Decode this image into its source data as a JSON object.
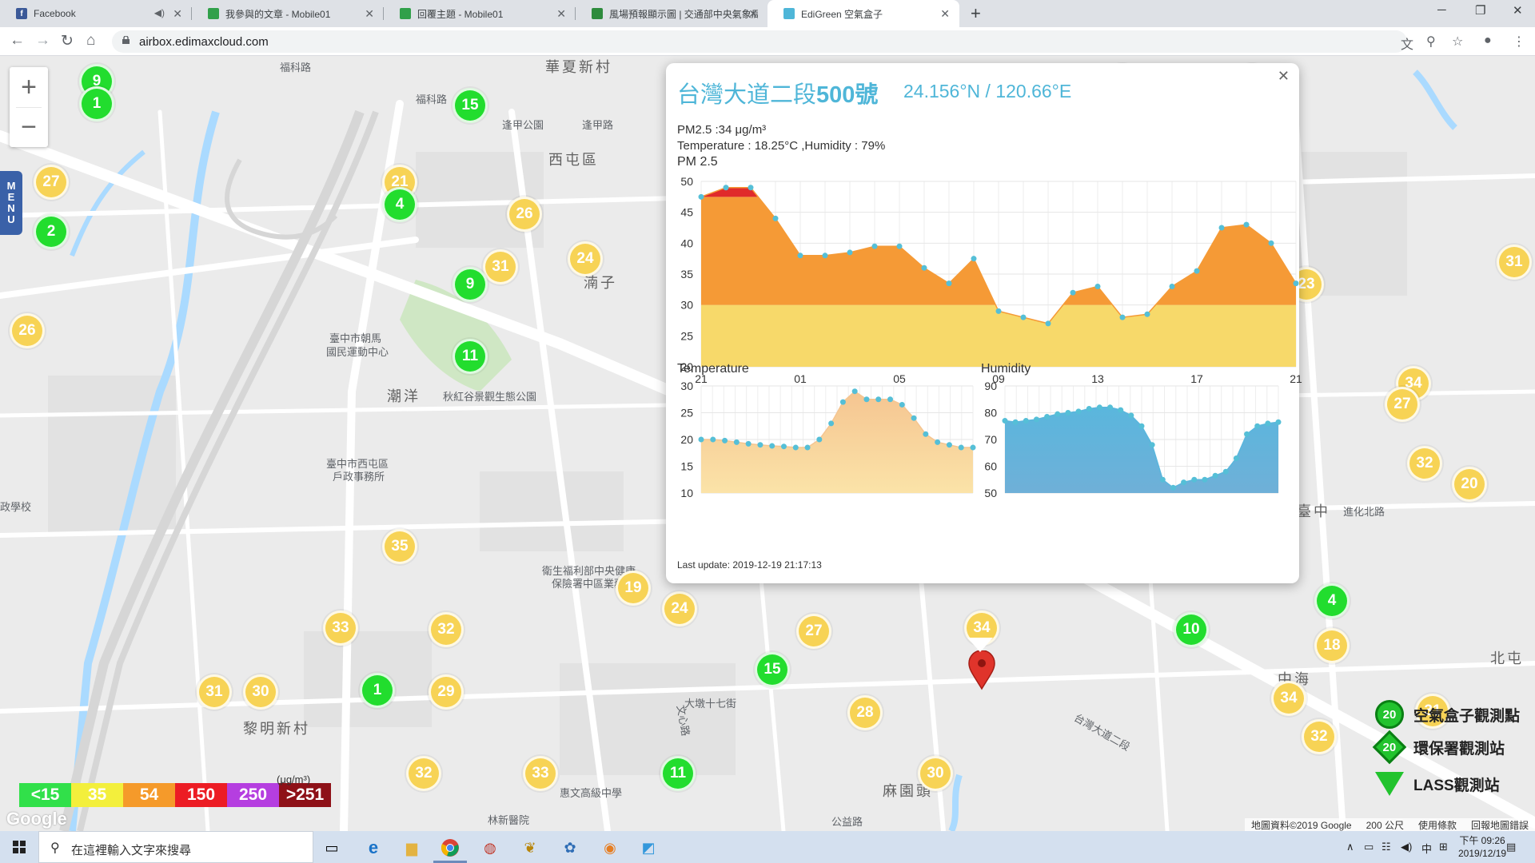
{
  "browser": {
    "tabs": [
      {
        "title": "Facebook",
        "fav": "f",
        "color": "#3b5998",
        "muted": true
      },
      {
        "title": "我參與的文章 - Mobile01",
        "fav": "",
        "color": "#31a04a"
      },
      {
        "title": "回覆主題 - Mobile01",
        "fav": "",
        "color": "#31a04a"
      },
      {
        "title": "風場預報顯示圖 | 交通部中央氣象局",
        "fav": "",
        "color": "#2e8b3d"
      },
      {
        "title": "EdiGreen 空氣盒子",
        "fav": "",
        "color": "#4fb6d8"
      }
    ],
    "url": "airbox.edimaxcloud.com"
  },
  "map": {
    "labels": [
      {
        "text": "華夏新村",
        "big": true
      },
      {
        "text": "西屯區",
        "big": true
      },
      {
        "text": "福科路"
      },
      {
        "text": "福科路"
      },
      {
        "text": "逢甲公園"
      },
      {
        "text": "逢甲路"
      },
      {
        "text": "湳子",
        "big": true
      },
      {
        "text": "潮洋",
        "big": true
      },
      {
        "text": "秋紅谷景觀生態公園"
      },
      {
        "text": "臺中市朝馬"
      },
      {
        "text": "國民運動中心"
      },
      {
        "text": "臺中市西屯區"
      },
      {
        "text": "戶政事務所"
      },
      {
        "text": "衛生福利部中央健康"
      },
      {
        "text": "保險署中區業務組"
      },
      {
        "text": "黎明新村",
        "big": true
      },
      {
        "text": "麻園頭",
        "big": true
      },
      {
        "text": "中海",
        "big": true
      },
      {
        "text": "台灣大道二段"
      },
      {
        "text": "文心路"
      },
      {
        "text": "臺中",
        "big": true
      },
      {
        "text": "進化北路"
      },
      {
        "text": "北屯",
        "big": true
      },
      {
        "text": "公益路"
      },
      {
        "text": "政學校"
      },
      {
        "text": "大墩十七街"
      },
      {
        "text": "惠文高級中學"
      },
      {
        "text": "林新醫院"
      }
    ],
    "markers": [
      {
        "v": "9",
        "c": "green"
      },
      {
        "v": "1",
        "c": "green"
      },
      {
        "v": "27",
        "c": "yellow"
      },
      {
        "v": "2",
        "c": "green"
      },
      {
        "v": "26",
        "c": "yellow"
      },
      {
        "v": "15",
        "c": "green"
      },
      {
        "v": "21",
        "c": "yellow"
      },
      {
        "v": "4",
        "c": "green"
      },
      {
        "v": "26",
        "c": "yellow"
      },
      {
        "v": "31",
        "c": "yellow"
      },
      {
        "v": "24",
        "c": "yellow"
      },
      {
        "v": "9",
        "c": "green"
      },
      {
        "v": "11",
        "c": "green"
      },
      {
        "v": "28",
        "c": "yellow"
      },
      {
        "v": "26",
        "c": "yellow"
      },
      {
        "v": "23",
        "c": "yellow"
      },
      {
        "v": "31",
        "c": "yellow"
      },
      {
        "v": "34",
        "c": "yellow"
      },
      {
        "v": "27",
        "c": "yellow"
      },
      {
        "v": "32",
        "c": "yellow"
      },
      {
        "v": "20",
        "c": "yellow"
      },
      {
        "v": "4",
        "c": "green"
      },
      {
        "v": "18",
        "c": "yellow"
      },
      {
        "v": "10",
        "c": "green"
      },
      {
        "v": "35",
        "c": "yellow"
      },
      {
        "v": "19",
        "c": "yellow"
      },
      {
        "v": "24",
        "c": "yellow"
      },
      {
        "v": "27",
        "c": "yellow"
      },
      {
        "v": "34",
        "c": "yellow"
      },
      {
        "v": "33",
        "c": "yellow"
      },
      {
        "v": "32",
        "c": "yellow"
      },
      {
        "v": "15",
        "c": "green"
      },
      {
        "v": "1",
        "c": "green"
      },
      {
        "v": "29",
        "c": "yellow"
      },
      {
        "v": "31",
        "c": "yellow"
      },
      {
        "v": "30",
        "c": "yellow"
      },
      {
        "v": "28",
        "c": "yellow"
      },
      {
        "v": "30",
        "c": "yellow"
      },
      {
        "v": "11",
        "c": "green"
      },
      {
        "v": "32",
        "c": "yellow"
      },
      {
        "v": "33",
        "c": "yellow"
      },
      {
        "v": "34",
        "c": "yellow"
      },
      {
        "v": "32",
        "c": "yellow"
      },
      {
        "v": "31",
        "c": "yellow"
      }
    ],
    "legend": [
      {
        "label": "<15",
        "color": "#31e04a"
      },
      {
        "label": "35",
        "color": "#f3ef3c"
      },
      {
        "label": "54",
        "color": "#f59a2a"
      },
      {
        "label": "150",
        "color": "#ec1c24"
      },
      {
        "label": "250",
        "color": "#b53ee0"
      },
      {
        "label": ">251",
        "color": "#8e1118"
      }
    ],
    "legend_unit": "(μg/m³)",
    "icon_keys": [
      {
        "label": "空氣盒子觀測點",
        "value": "20",
        "shape": "circle"
      },
      {
        "label": "環保署觀測站",
        "value": "20",
        "shape": "diamond"
      },
      {
        "label": "LASS觀測站",
        "value": "20",
        "shape": "tri"
      }
    ],
    "attribution": [
      "地圖資料©2019 Google",
      "200 公尺",
      "使用條款",
      "回報地圖錯誤"
    ],
    "menu_label": "MENU"
  },
  "popup": {
    "title_prefix": "台灣大道二段",
    "title_number": "500號",
    "coords": "24.156°N / 120.66°E",
    "pm_line": "PM2.5 :34 μg/m³",
    "temp_humidity_line": "Temperature : 18.25°C ,Humidity : 79%",
    "last_update": "Last update: 2019-12-19 21:17:13"
  },
  "chart_data": [
    {
      "type": "area",
      "title": "PM 2.5",
      "categories": [
        "21",
        "01",
        "05",
        "09",
        "13",
        "17",
        "21"
      ],
      "ylim": [
        20,
        50
      ],
      "yticks": [
        20,
        25,
        30,
        35,
        40,
        45,
        50
      ],
      "values": [
        47.5,
        49,
        49,
        44,
        38,
        38,
        38.5,
        39.5,
        39.5,
        36,
        33.5,
        37.5,
        29,
        28,
        27,
        32,
        33,
        28,
        28.5,
        33,
        35.5,
        42.5,
        43,
        40,
        33.5
      ],
      "colors": {
        "high": "#f59a36",
        "low": "#f7d96a",
        "peak": "#e02b2b"
      }
    },
    {
      "type": "area",
      "title": "Temperature",
      "ylim": [
        10,
        30
      ],
      "yticks": [
        10,
        15,
        20,
        25,
        30
      ],
      "values": [
        20,
        20,
        19.8,
        19.5,
        19.2,
        19,
        18.8,
        18.7,
        18.5,
        18.5,
        20,
        23,
        27,
        29,
        27.5,
        27.5,
        27.5,
        26.5,
        24,
        21,
        19.5,
        19,
        18.5,
        18.5
      ],
      "colors": {
        "fill": "#f5c591",
        "line": "#55bfd7"
      }
    },
    {
      "type": "area",
      "title": "Humidity",
      "ylim": [
        50,
        90
      ],
      "yticks": [
        50,
        60,
        70,
        80,
        90
      ],
      "values": [
        77,
        76.5,
        77,
        77.5,
        78.5,
        79.5,
        80,
        80.5,
        81.5,
        82,
        82,
        81,
        79,
        75,
        68,
        55,
        52,
        54,
        55,
        55,
        56.5,
        58,
        63,
        72,
        75,
        76,
        76.5
      ],
      "colors": {
        "fill": "#5ab6dd",
        "line": "#55bfd7"
      }
    }
  ],
  "taskbar": {
    "search_placeholder": "在這裡輸入文字來搜尋",
    "time": "下午 09:26",
    "date": "2019/12/19",
    "ime": "中"
  }
}
